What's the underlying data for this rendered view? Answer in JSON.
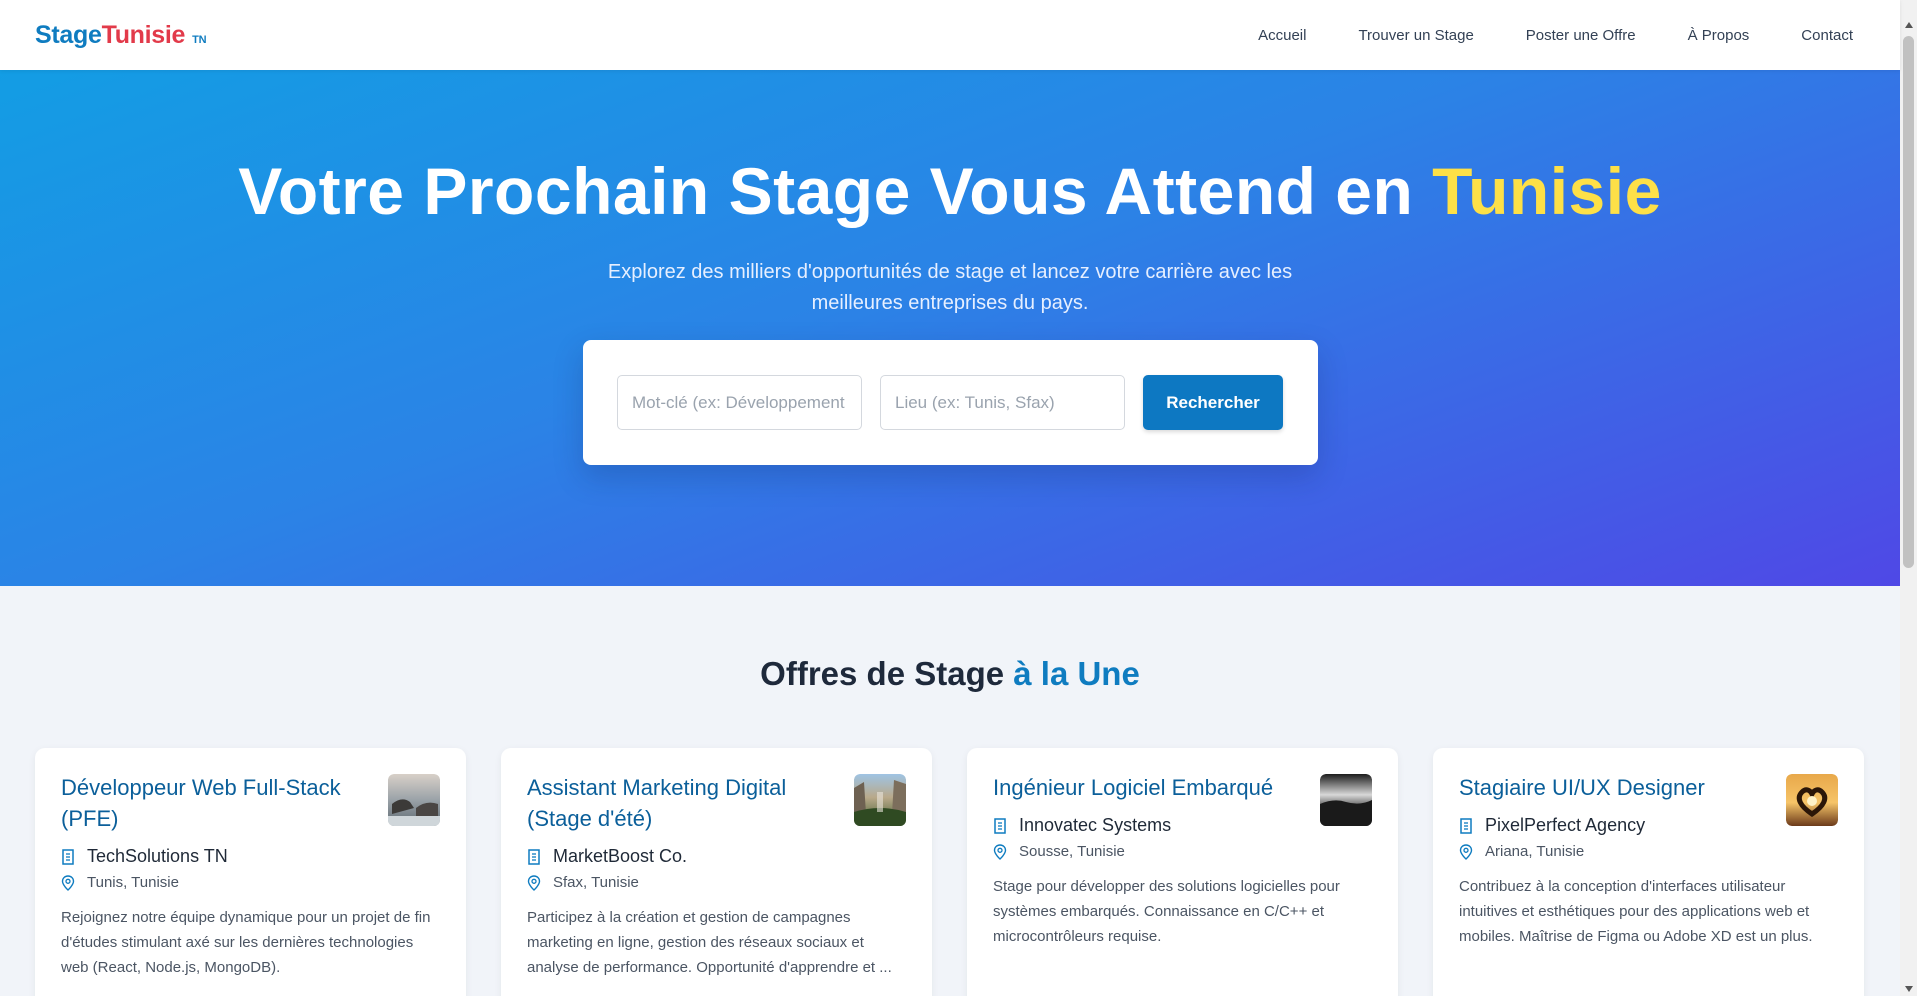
{
  "header": {
    "logo_part1": "Stage",
    "logo_part2": "Tunisie",
    "logo_tag": "TN",
    "nav": [
      "Accueil",
      "Trouver un Stage",
      "Poster une Offre",
      "À Propos",
      "Contact"
    ]
  },
  "hero": {
    "title_main": "Votre Prochain Stage Vous Attend en ",
    "title_highlight": "Tunisie",
    "subtitle": "Explorez des milliers d'opportunités de stage et lancez votre carrière avec les meilleures entreprises du pays.",
    "keyword_placeholder": "Mot-clé (ex: Développement Web)",
    "location_placeholder": "Lieu (ex: Tunis, Sfax)",
    "search_label": "Rechercher"
  },
  "featured": {
    "title_main": "Offres de Stage ",
    "title_highlight": "à la Une",
    "offers": [
      {
        "title": "Développeur Web Full-Stack (PFE)",
        "company": "TechSolutions TN",
        "location": "Tunis, Tunisie",
        "description": "Rejoignez notre équipe dynamique pour un projet de fin d'études stimulant axé sur les dernières technologies web (React, Node.js, MongoDB).",
        "thumb": "coast-rock-photo"
      },
      {
        "title": "Assistant Marketing Digital (Stage d'été)",
        "company": "MarketBoost Co.",
        "location": "Sfax, Tunisie",
        "description": "Participez à la création et gestion de campagnes marketing en ligne, gestion des réseaux sociaux et analyse de performance. Opportunité d'apprendre et ...",
        "thumb": "valley-photo"
      },
      {
        "title": "Ingénieur Logiciel Embarqué",
        "company": "Innovatec Systems",
        "location": "Sousse, Tunisie",
        "description": "Stage pour développer des solutions logicielles pour systèmes embarqués. Connaissance en C/C++ et microcontrôleurs requise.",
        "thumb": "landscape-bw-photo"
      },
      {
        "title": "Stagiaire UI/UX Designer",
        "company": "PixelPerfect Agency",
        "location": "Ariana, Tunisie",
        "description": "Contribuez à la conception d'interfaces utilisateur intuitives et esthétiques pour des applications web et mobiles. Maîtrise de Figma ou Adobe XD est un plus.",
        "thumb": "heart-hands-sunset-photo"
      }
    ]
  },
  "colors": {
    "brand_blue": "#0f7cc0",
    "brand_red": "#e23a4a",
    "highlight_yellow": "#fde047"
  }
}
